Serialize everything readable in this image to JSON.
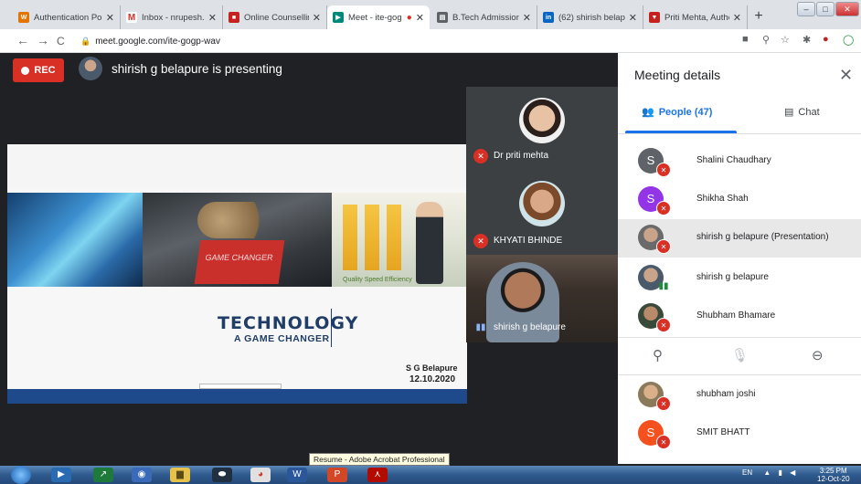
{
  "browser": {
    "tabs": [
      {
        "label": "Authentication Por",
        "favicon": "auth-favicon",
        "color": "#e37400"
      },
      {
        "label": "Inbox - nrupesh.p",
        "favicon": "gmail-favicon",
        "color": "#d93025"
      },
      {
        "label": "Online Counselling",
        "favicon": "red-favicon",
        "color": "#c5221f"
      },
      {
        "label": "Meet - ite-gog",
        "favicon": "meet-favicon",
        "color": "#00897b"
      },
      {
        "label": "B.Tech Admission",
        "favicon": "doc-favicon",
        "color": "#5f6368"
      },
      {
        "label": "(62) shirish belapu",
        "favicon": "linkedin-favicon",
        "color": "#0a66c2"
      },
      {
        "label": "Priti Mehta, Autho",
        "favicon": "author-favicon",
        "color": "#c5221f"
      }
    ],
    "url": "meet.google.com/ite-gogp-wav",
    "new_tab": "+",
    "back": "←",
    "forward": "→",
    "reload": "C"
  },
  "meet": {
    "rec_label": "REC",
    "presenting_text": "shirish g belapure is presenting",
    "slide": {
      "title": "TECHNOLOGY",
      "subtitle": "A GAME CHANGER",
      "author": "S G Belapure",
      "date": "12.10.2020",
      "image_tags": "Quality  Speed  Efficiency",
      "game_changer_text": "GAME CHANGER"
    },
    "tiles": [
      {
        "name": "Dr priti mehta",
        "muted": true
      },
      {
        "name": "KHYATI BHINDE",
        "muted": true
      },
      {
        "name": "shirish g belapure",
        "muted": false
      }
    ]
  },
  "panel": {
    "title": "Meeting details",
    "tab_people": "People (47)",
    "tab_chat": "Chat",
    "participants": [
      {
        "initial": "S",
        "name": "Shalini Chaudhary",
        "avatar_color": "#5f6368",
        "muted": true
      },
      {
        "initial": "S",
        "name": "Shikha Shah",
        "avatar_color": "#9334e6",
        "muted": true
      },
      {
        "initial": "",
        "name": "shirish g belapure (Presentation)",
        "avatar_color": "#7a7a7a",
        "muted": true
      },
      {
        "initial": "",
        "name": "shirish g belapure",
        "avatar_color": "#7a6a5a",
        "muted": false
      },
      {
        "initial": "",
        "name": "Shubham Bhamare",
        "avatar_color": "#5a6a4a",
        "muted": true
      },
      {
        "initial": "",
        "name": "shubham joshi",
        "avatar_color": "#8a7a5a",
        "muted": true
      },
      {
        "initial": "S",
        "name": "SMIT BHATT",
        "avatar_color": "#f4511e",
        "muted": true
      }
    ]
  },
  "tooltip": "Resume - Adobe Acrobat Professional",
  "taskbar": {
    "lang": "EN",
    "time": "3:25 PM",
    "date": "12-Oct-20"
  }
}
